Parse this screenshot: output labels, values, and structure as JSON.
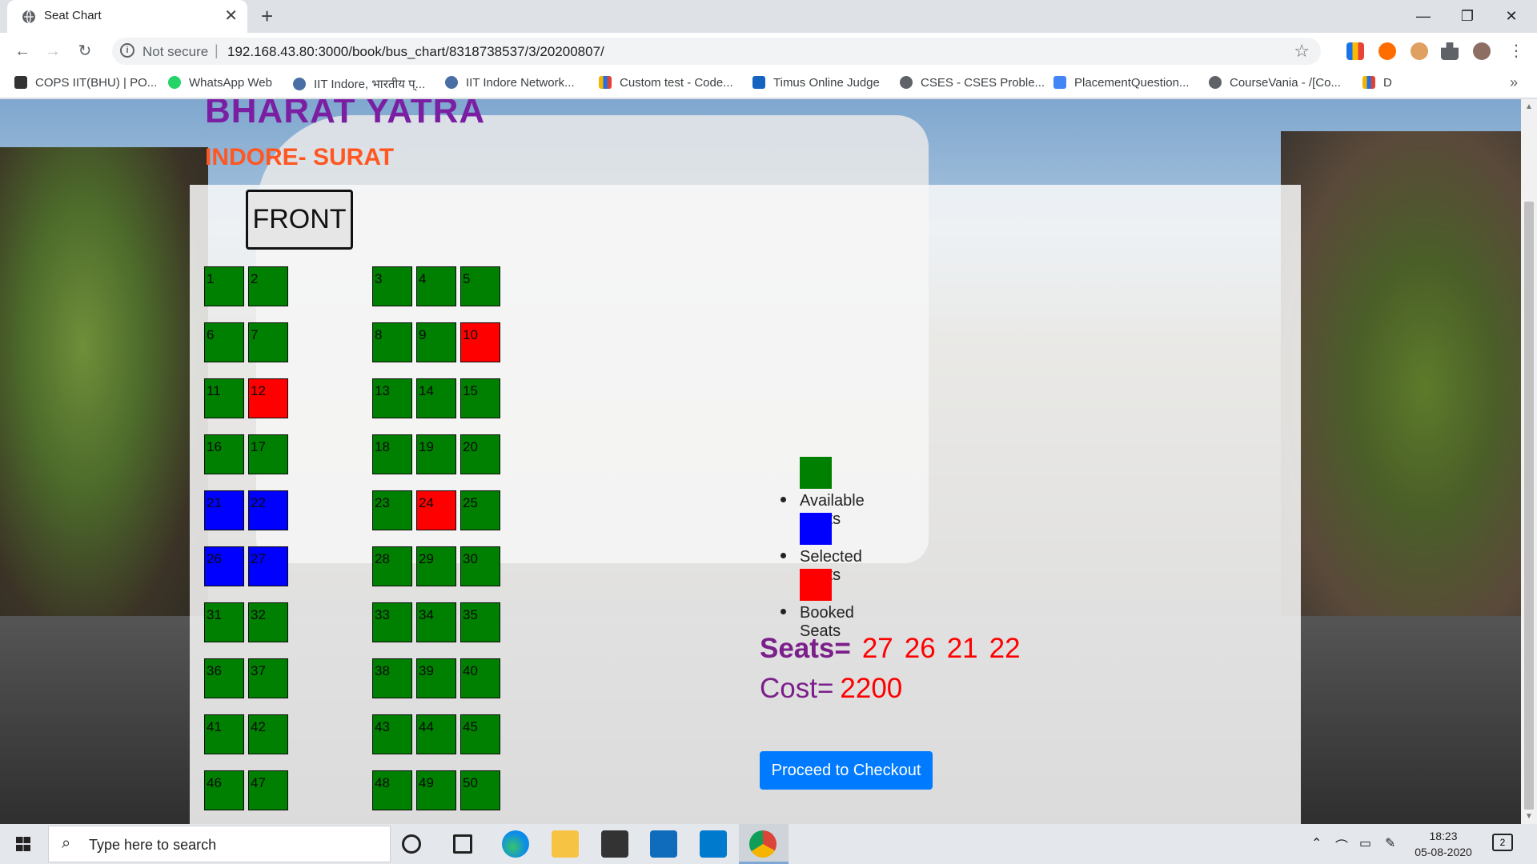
{
  "browser": {
    "tab_title": "Seat Chart",
    "tab_close": "✕",
    "new_tab": "+",
    "window_controls": [
      "—",
      "❐",
      "✕"
    ],
    "security_text": "Not secure",
    "url": "192.168.43.80:3000/book/bus_chart/8318738537/3/20200807/",
    "bookmarks": [
      {
        "label": "COPS IIT(BHU) | PO...",
        "icon": "cops-icon",
        "color": "#333333"
      },
      {
        "label": "WhatsApp Web",
        "icon": "whatsapp-icon",
        "color": "#25d366"
      },
      {
        "label": "IIT Indore, भारतीय प्...",
        "icon": "iit-indore-icon",
        "color": "#4a6fa5"
      },
      {
        "label": "IIT Indore Network...",
        "icon": "iit-network-icon",
        "color": "#4a6fa5"
      },
      {
        "label": "Custom test - Code...",
        "icon": "codeforces-icon",
        "color": "#f4b400"
      },
      {
        "label": "Timus Online Judge",
        "icon": "timus-icon",
        "color": "#1565c0"
      },
      {
        "label": "CSES - CSES Proble...",
        "icon": "globe-icon",
        "color": "#5f6368"
      },
      {
        "label": "PlacementQuestion...",
        "icon": "doc-icon",
        "color": "#4285f4"
      },
      {
        "label": "CourseVania - /[Co...",
        "icon": "globe-icon",
        "color": "#5f6368"
      },
      {
        "label": "D",
        "icon": "codeforces-icon",
        "color": "#f4b400"
      }
    ],
    "bookmarks_more": "»"
  },
  "page": {
    "brand": "BHARAT YATRA",
    "route": "INDORE- SURAT",
    "front_label": "FRONT",
    "seats": [
      {
        "number": "1",
        "status": "available"
      },
      {
        "number": "2",
        "status": "available"
      },
      {
        "number": "3",
        "status": "available"
      },
      {
        "number": "4",
        "status": "available"
      },
      {
        "number": "5",
        "status": "available"
      },
      {
        "number": "6",
        "status": "available"
      },
      {
        "number": "7",
        "status": "available"
      },
      {
        "number": "8",
        "status": "available"
      },
      {
        "number": "9",
        "status": "available"
      },
      {
        "number": "10",
        "status": "booked"
      },
      {
        "number": "11",
        "status": "available"
      },
      {
        "number": "12",
        "status": "booked"
      },
      {
        "number": "13",
        "status": "available"
      },
      {
        "number": "14",
        "status": "available"
      },
      {
        "number": "15",
        "status": "available"
      },
      {
        "number": "16",
        "status": "available"
      },
      {
        "number": "17",
        "status": "available"
      },
      {
        "number": "18",
        "status": "available"
      },
      {
        "number": "19",
        "status": "available"
      },
      {
        "number": "20",
        "status": "available"
      },
      {
        "number": "21",
        "status": "selected"
      },
      {
        "number": "22",
        "status": "selected"
      },
      {
        "number": "23",
        "status": "available"
      },
      {
        "number": "24",
        "status": "booked"
      },
      {
        "number": "25",
        "status": "available"
      },
      {
        "number": "26",
        "status": "selected"
      },
      {
        "number": "27",
        "status": "selected"
      },
      {
        "number": "28",
        "status": "available"
      },
      {
        "number": "29",
        "status": "available"
      },
      {
        "number": "30",
        "status": "available"
      },
      {
        "number": "31",
        "status": "available"
      },
      {
        "number": "32",
        "status": "available"
      },
      {
        "number": "33",
        "status": "available"
      },
      {
        "number": "34",
        "status": "available"
      },
      {
        "number": "35",
        "status": "available"
      },
      {
        "number": "36",
        "status": "available"
      },
      {
        "number": "37",
        "status": "available"
      },
      {
        "number": "38",
        "status": "available"
      },
      {
        "number": "39",
        "status": "available"
      },
      {
        "number": "40",
        "status": "available"
      },
      {
        "number": "41",
        "status": "available"
      },
      {
        "number": "42",
        "status": "available"
      },
      {
        "number": "43",
        "status": "available"
      },
      {
        "number": "44",
        "status": "available"
      },
      {
        "number": "45",
        "status": "available"
      },
      {
        "number": "46",
        "status": "available"
      },
      {
        "number": "47",
        "status": "available"
      },
      {
        "number": "48",
        "status": "available"
      },
      {
        "number": "49",
        "status": "available"
      },
      {
        "number": "50",
        "status": "available"
      }
    ],
    "legend": [
      {
        "label": "Available Seats",
        "color": "#008000"
      },
      {
        "label": "Selected Seats",
        "color": "#0000ff"
      },
      {
        "label": "Booked Seats",
        "color": "#ff0000"
      }
    ],
    "seats_label": "Seats=",
    "selected_seats": [
      "27",
      "26",
      "21",
      "22"
    ],
    "cost_label": "Cost=",
    "cost_value": "2200",
    "checkout_label": "Proceed to Checkout"
  },
  "taskbar": {
    "search_placeholder": "Type here to search",
    "time": "18:23",
    "date": "05-08-2020",
    "notifications": "2",
    "apps": [
      {
        "icon": "task-view-icon",
        "color": "#222222"
      },
      {
        "icon": "timeline-icon",
        "color": "#222222"
      },
      {
        "icon": "edge-icon",
        "color": "#0c8ce9"
      },
      {
        "icon": "file-explorer-icon",
        "color": "#f6c343"
      },
      {
        "icon": "store-icon",
        "color": "#333333"
      },
      {
        "icon": "mail-icon",
        "color": "#0f6cbd"
      },
      {
        "icon": "vscode-icon",
        "color": "#007acc"
      },
      {
        "icon": "chrome-icon",
        "color": "#db4437"
      }
    ]
  },
  "colors": {
    "available": "#008000",
    "selected": "#0000ff",
    "booked": "#ff0000",
    "brand": "#7b1fa2",
    "route": "#ff5722",
    "accent_button": "#007bff"
  }
}
